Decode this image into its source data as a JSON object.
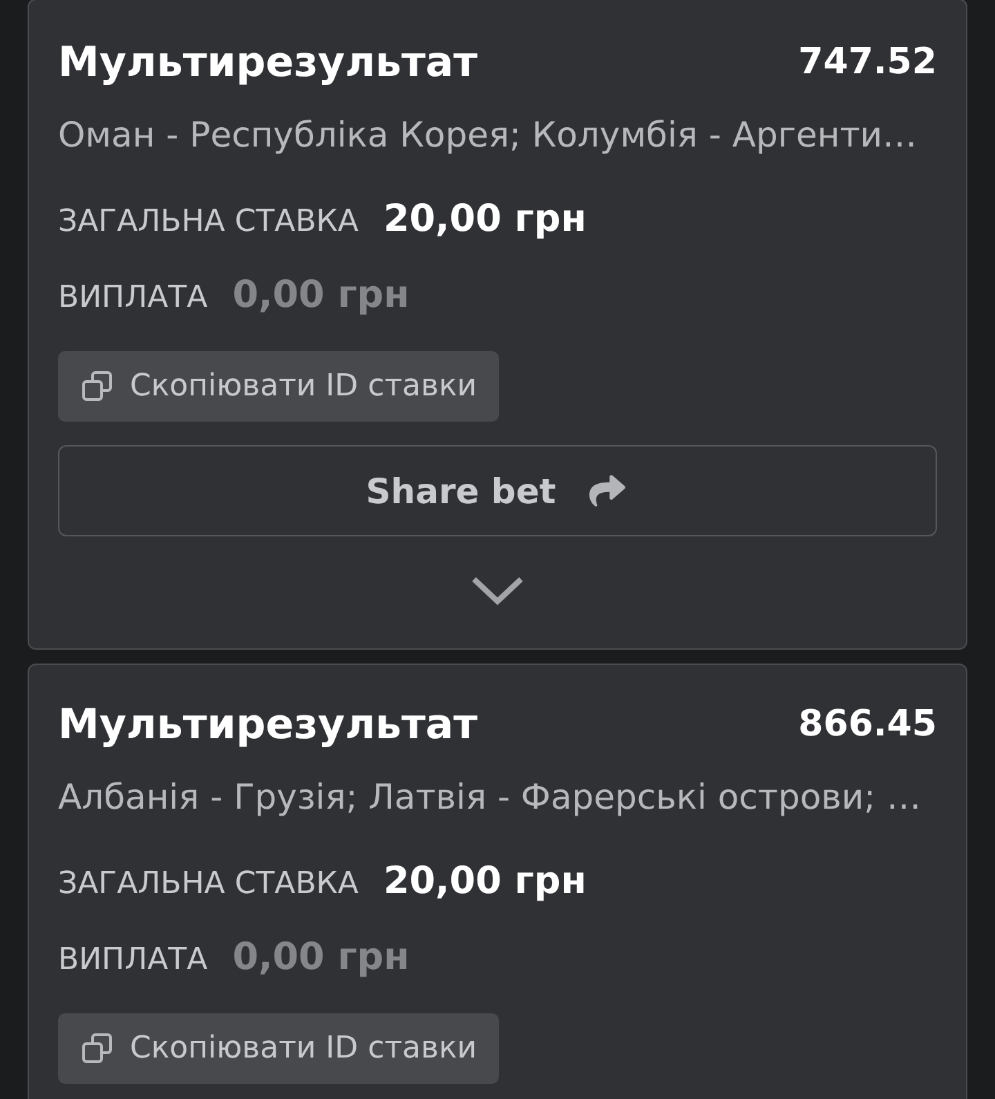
{
  "bets": [
    {
      "type": "Мультирезультат",
      "odds": "747.52",
      "events": "Оман - Республіка Корея; Колумбія - Аргенти…",
      "stake": {
        "label": "ЗАГАЛЬНА СТАВКА",
        "value": "20,00 грн"
      },
      "payout": {
        "label": "ВИПЛАТА",
        "value": "0,00 грн"
      },
      "copy_button": "Скопіювати ID ставки",
      "share_button": "Share bet",
      "expanded": false
    },
    {
      "type": "Мультирезультат",
      "odds": "866.45",
      "events": "Албанія - Грузія; Латвія - Фарерські острови; …",
      "stake": {
        "label": "ЗАГАЛЬНА СТАВКА",
        "value": "20,00 грн"
      },
      "payout": {
        "label": "ВИПЛАТА",
        "value": "0,00 грн"
      },
      "copy_button": "Скопіювати ID ставки"
    }
  ]
}
